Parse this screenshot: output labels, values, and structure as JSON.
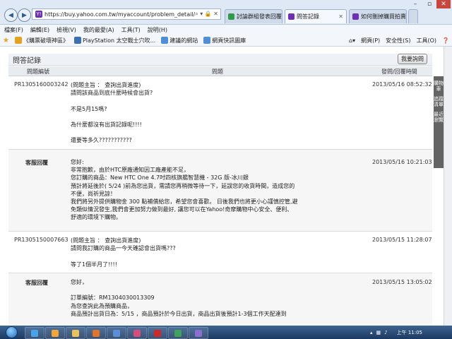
{
  "browser": {
    "url": "https://buy.yahoo.com.tw/myaccount/problem_detail/",
    "tabs": [
      {
        "label": "討論群組發表回覆",
        "active": false,
        "color": "#2f9b4a"
      },
      {
        "label": "問答記錄",
        "active": true,
        "color": "#6d2fb3"
      },
      {
        "label": "如何刪掉購買拍賣存...",
        "active": false,
        "color": "#6d2fb3"
      }
    ],
    "menu": [
      "檔案(F)",
      "編輯(E)",
      "檢視(V)",
      "我的最愛(A)",
      "工具(T)",
      "說明(H)"
    ],
    "favorites": [
      {
        "label": "《購票破壞神區》",
        "color": "#e5a31d"
      },
      {
        "label": "PlayStation 太空戰士穴吹...",
        "color": "#3b6fb8"
      },
      {
        "label": "建議的網站",
        "color": "#4f8fd8"
      },
      {
        "label": "網頁快訊圖庫",
        "color": "#4f8fd8"
      }
    ],
    "right_tools": [
      "網頁(P)",
      "安全性(S)",
      "工具(O)"
    ]
  },
  "page": {
    "title": "問答記錄",
    "ask_button": "我要詢問",
    "columns": {
      "id": "問題編號",
      "question": "問題",
      "time": "發問/回覆時間"
    },
    "side_tabs": [
      "購物車",
      "追蹤清單",
      "最近瀏覽"
    ],
    "rows": [
      {
        "id": "PR1305160003242",
        "time": "2013/05/16 08:52:32",
        "reply": false,
        "text": "(問題主旨 ： 查詢出貨進度)\n請問該商品到底什麼時候會出貨?\n\n不是5月15嗎?\n\n為什麼都沒有出貨記錄呢!!!!\n\n還要等多久???????????"
      },
      {
        "id": "客服回覆",
        "time": "2013/05/16 10:21:03",
        "reply": true,
        "text": "您好:\n非常抱歉，由於HTC原廠通知因工廠產能不足，\n您訂購的商品：New HTC One 4.7吋四核旗艦智慧機 - 32G 版-冰川銀\n預計將延後於( 5/24 )前為您出貨，需請您再稍微等待一下，延誤您的收貨時間，造成您的\n不便，尚祈見諒！\n我們將另外提供購物金 300 點補償給您，希望您會喜歡。 日後我們也將更小心謹慎控管,避\n免類似情況發生,我們會更加努力做到最好, 讓您可以在Yahoo!奇摩購物中心安全、便利、\n舒適的環境下購物。"
      },
      {
        "id": "PR1305150007663",
        "time": "2013/05/15 11:28:07",
        "reply": false,
        "text": "(問題主旨 ： 查詢出貨進度)\n請問我訂購的商品一今天確認會出貨嗎???\n\n等了1個半月了!!!!"
      },
      {
        "id": "客服回覆",
        "time": "2013/05/15 13:05:02",
        "reply": true,
        "text": "您好，\n\n訂單編號：RM1304030013309\n為您查詢此為預購商品，\n商品預計出貨日為：5/15 ，商品預計於今日出貨，商品出貨後預計1-3個工作天配達到"
      }
    ]
  },
  "taskbar": {
    "clock": "上午 11:05"
  }
}
